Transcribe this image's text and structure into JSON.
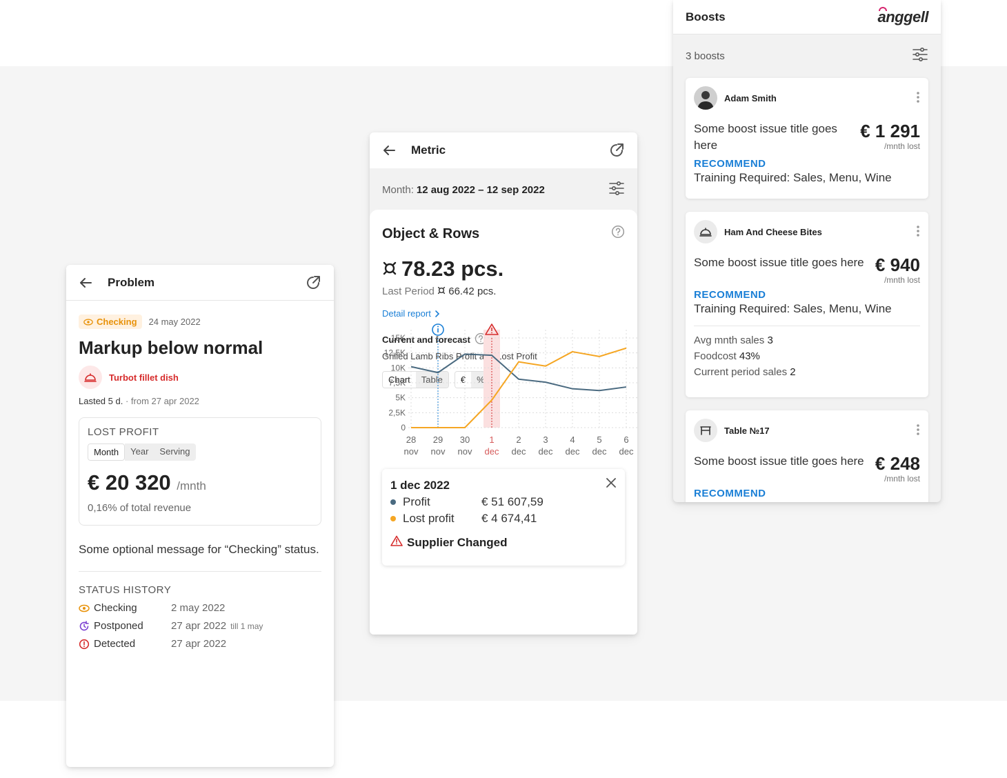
{
  "problem": {
    "title": "Problem",
    "status_badge": "Checking",
    "date": "24 may 2022",
    "heading": "Markup below normal",
    "dish": "Turbot fillet dish",
    "lasted": "Lasted 5 d.",
    "from": "· from 27 apr 2022",
    "lost_profit_label": "LOST PROFIT",
    "periods": [
      "Month",
      "Year",
      "Serving"
    ],
    "value": "€ 20 320",
    "value_unit": "/mnth",
    "revenue_share": "0,16% of total revenue",
    "message": "Some optional message for “Checking” status.",
    "status_history_label": "STATUS HISTORY",
    "history": [
      {
        "name": "Checking",
        "date": "2 may 2022",
        "till": "",
        "color": "#e8920a"
      },
      {
        "name": "Postponed",
        "date": "27 apr 2022",
        "till": "till 1 may",
        "color": "#7b3fd1"
      },
      {
        "name": "Detected",
        "date": "27 apr 2022",
        "till": "",
        "color": "#d62b2b"
      }
    ]
  },
  "metric": {
    "title": "Metric",
    "month_label": "Month:",
    "month_value": "12 aug 2022 – 12 sep 2022",
    "card_title": "Object & Rows",
    "value": "78.23 pcs.",
    "last_period_label": "Last Period",
    "last_period_value": "66.42 pcs.",
    "detail_link": "Detail report",
    "forecast_title": "Current and forecast",
    "forecast_sub": "Grilled Lamb Ribs Profit and Lost Profit",
    "view_toggle": [
      "Chart",
      "Table"
    ],
    "unit_toggle": [
      "€",
      "%"
    ],
    "tooltip": {
      "date": "1 dec 2022",
      "rows": [
        {
          "name": "Profit",
          "value": "€ 51 607,59",
          "color": "#4a6a80"
        },
        {
          "name": "Lost profit",
          "value": "€ 4 674,41",
          "color": "#f5a623"
        }
      ],
      "warning": "Supplier Changed"
    }
  },
  "chart_data": {
    "type": "line",
    "x": [
      "28 nov",
      "29 nov",
      "30 nov",
      "1 dec",
      "2 dec",
      "3 dec",
      "4 dec",
      "5 dec",
      "6 dec"
    ],
    "ytick_labels": [
      "0",
      "2,5K",
      "5K",
      "7,5K",
      "10K",
      "12,5K",
      "15K"
    ],
    "ylim": [
      0,
      15000
    ],
    "grid": true,
    "highlight_x": "1 dec",
    "info_marker_x": "29 nov",
    "series": [
      {
        "color": "#4a6a80",
        "values": [
          10200,
          9200,
          12300,
          12100,
          8100,
          7600,
          6500,
          6200,
          6800
        ]
      },
      {
        "color": "#f5a623",
        "values": [
          0,
          0,
          0,
          4600,
          11000,
          10300,
          12700,
          11900,
          13300
        ]
      }
    ]
  },
  "boosts": {
    "title": "Boosts",
    "logo": "anggell",
    "count": "3 boosts",
    "items": [
      {
        "name": "Adam Smith",
        "title": "Some boost issue title goes here",
        "amount": "€ 1 291",
        "unit": "/mnth lost",
        "rec_label": "RECOMMEND",
        "rec_text": "Training Required: Sales, Menu, Wine"
      },
      {
        "name": "Ham And Cheese Bites",
        "title": "Some boost issue title goes here",
        "amount": "€ 940",
        "unit": "/mnth lost",
        "rec_label": "RECOMMEND",
        "rec_text": "Training Required: Sales, Menu, Wine",
        "stats": [
          {
            "label": "Avg mnth sales",
            "value": "3"
          },
          {
            "label": "Foodcost",
            "value": "43%"
          },
          {
            "label": "Current period sales",
            "value": "2"
          }
        ]
      },
      {
        "name": "Table №17",
        "title": "Some boost issue title goes here",
        "amount": "€ 248",
        "unit": "/mnth lost",
        "rec_label": "RECOMMEND"
      }
    ]
  }
}
